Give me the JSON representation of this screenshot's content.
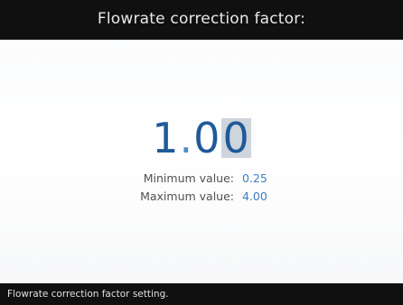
{
  "header": {
    "title": "Flowrate correction factor:"
  },
  "editor": {
    "value_integer": "1",
    "value_dot": ".",
    "value_fraction_head": "0",
    "value_fraction_cursor": "0"
  },
  "limits": {
    "minimum_label": "Minimum value:",
    "minimum_value": "0.25",
    "maximum_label": "Maximum value:",
    "maximum_value": "4.00"
  },
  "status": {
    "text": "Flowrate correction factor setting."
  },
  "colors": {
    "bar_background": "#101010",
    "value_color": "#1f5a98",
    "limit_value_color": "#3a7fc0",
    "cursor_highlight": "#cfd5dc"
  }
}
